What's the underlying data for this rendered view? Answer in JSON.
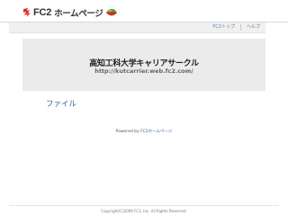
{
  "header": {
    "logo_fc2": "FC2",
    "logo_home": "ホームページ"
  },
  "nav": {
    "top_label": "FC2トップ",
    "help_label": "ヘルプ"
  },
  "site": {
    "title": "高知工科大学キャリアサークル",
    "url": "http://kutcarrier.web.fc2.com/"
  },
  "main": {
    "file_link": "ファイル"
  },
  "footer": {
    "powered_prefix": "Powered by ",
    "powered_link": "FC2ホームページ",
    "copyright": "Copyright(C)2006 FC2, Inc. All Rights Reserved."
  },
  "colors": {
    "link": "#3a5fa0",
    "header_bg": "#ebebeb",
    "nav_bg": "#f0f0f0",
    "logo_red": "#d9342b",
    "bowl_green": "#5aa02c"
  },
  "icons": {
    "logo_mark": "fc2-logo-icon",
    "bowl": "bowl-icon"
  }
}
